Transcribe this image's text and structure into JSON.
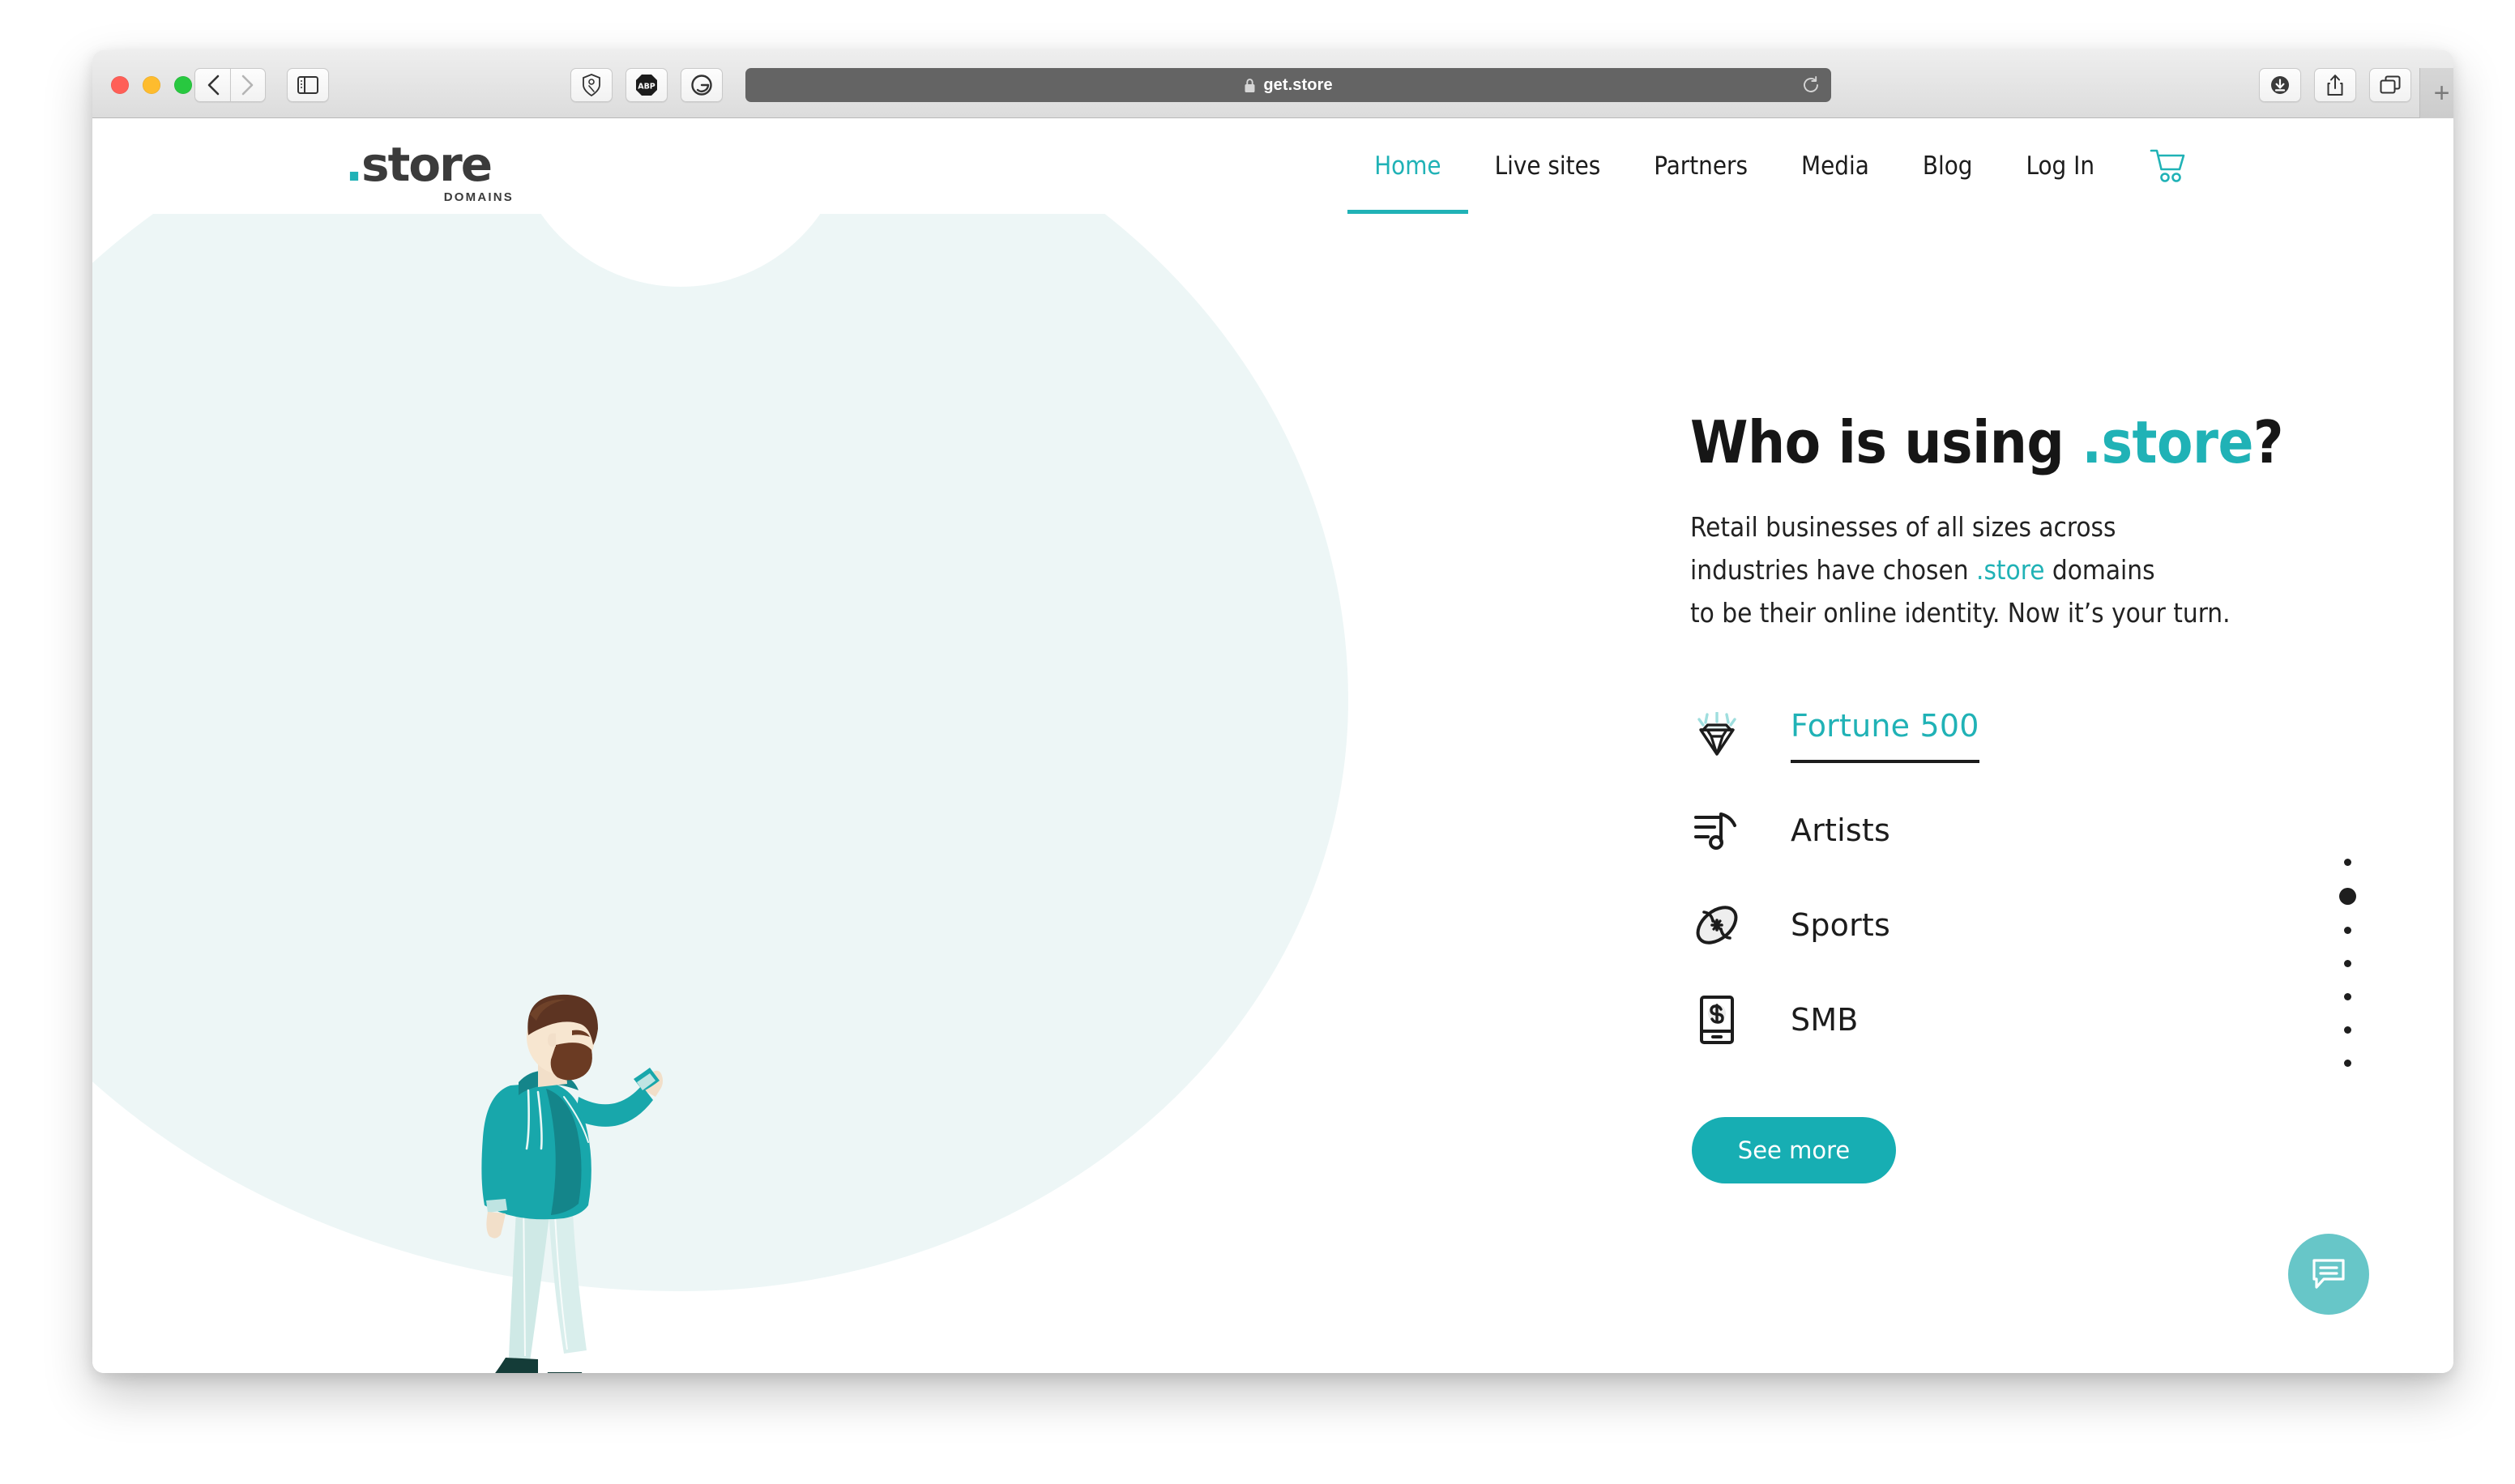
{
  "browser": {
    "traffic_lights": [
      "close",
      "minimize",
      "zoom"
    ],
    "back_label": "Back",
    "forward_label": "Forward",
    "sidebar_label": "Show Sidebar",
    "extensions": [
      {
        "name": "privacy-badger-extension",
        "label": "Privacy Badger"
      },
      {
        "name": "adblock-plus-extension",
        "label": "ABP"
      },
      {
        "name": "grammarly-extension",
        "label": "Grammarly"
      }
    ],
    "address": {
      "url": "get.store",
      "secure": true,
      "reload_label": "Reload"
    },
    "downloads_label": "Downloads",
    "share_label": "Share",
    "tabs_label": "Show Tab Overview",
    "new_tab_label": "+"
  },
  "site": {
    "logo": {
      "dot": ".",
      "word": "store",
      "subtitle": "DOMAINS"
    },
    "nav": [
      {
        "label": "Home",
        "active": true
      },
      {
        "label": "Live sites",
        "active": false
      },
      {
        "label": "Partners",
        "active": false
      },
      {
        "label": "Media",
        "active": false
      },
      {
        "label": "Blog",
        "active": false
      },
      {
        "label": "Log In",
        "active": false
      }
    ],
    "cart_label": "Cart"
  },
  "hero": {
    "title_plain": "Who is using ",
    "title_accent": ".store",
    "title_suffix": "?",
    "desc_line1": "Retail businesses of all sizes across",
    "desc_line2a": "industries have chosen ",
    "desc_line2_accent": ".store",
    "desc_line2b": " domains",
    "desc_line3": "to be their online identity. Now it’s your turn.",
    "categories": [
      {
        "label": "Fortune 500",
        "icon": "diamond-icon",
        "active": true
      },
      {
        "label": "Artists",
        "icon": "music-note-icon",
        "active": false
      },
      {
        "label": "Sports",
        "icon": "football-icon",
        "active": false
      },
      {
        "label": "SMB",
        "icon": "phone-dollar-icon",
        "active": false
      }
    ],
    "cta_label": "See more",
    "carousel": {
      "count": 7,
      "active_index": 1
    }
  },
  "widgets": {
    "chat_label": "Chat"
  },
  "colors": {
    "accent_teal": "#20b2b6",
    "button_teal": "#17aeb3",
    "chat_teal": "#67c6c8",
    "blob_mint": "#edf6f6",
    "text_dark": "#1c1c1c",
    "url_bar": "#646464"
  }
}
